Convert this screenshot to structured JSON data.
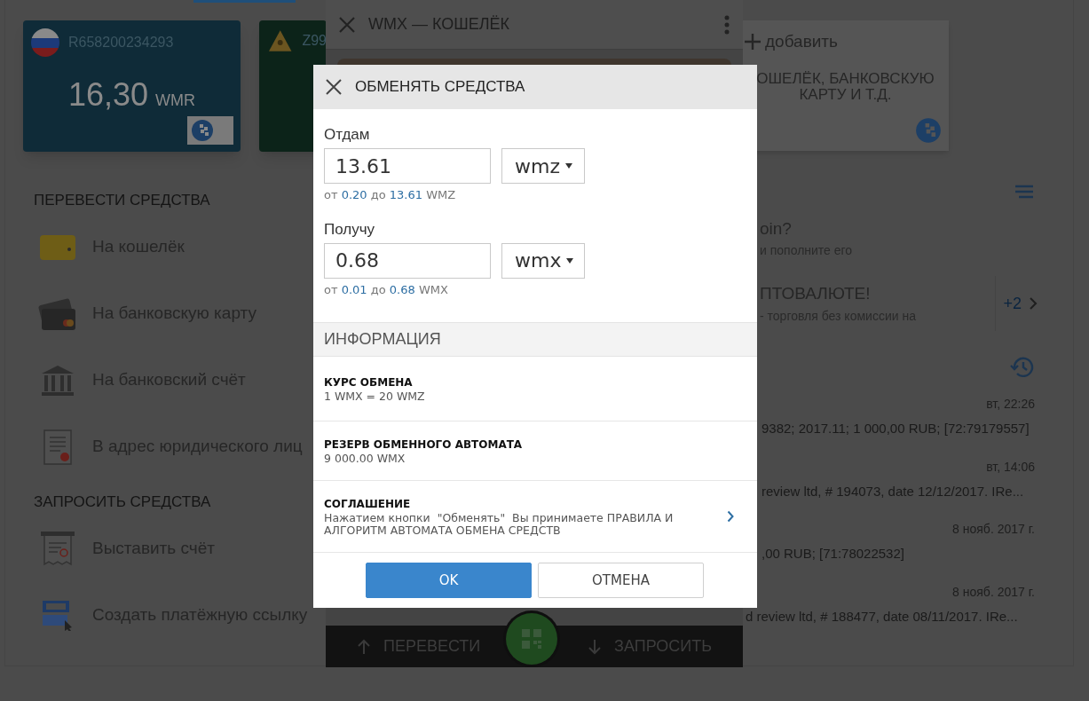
{
  "wallet_cards": [
    {
      "kind": "wmr",
      "number": "R658200234293",
      "amount": "16,30",
      "currency": "WMR"
    },
    {
      "kind": "wmz",
      "number": "Z99"
    }
  ],
  "add_card": {
    "label": "добавить",
    "lines": [
      "ОШЕЛЁК, БАНКОВСКУЮ",
      "КАРТУ И Т.Д."
    ]
  },
  "transfer": {
    "title": "ПЕРЕВЕСТИ СРЕДСТВА",
    "items": [
      {
        "kind": "wallet",
        "label": "На кошелёк"
      },
      {
        "kind": "card",
        "label": "На банковскую карту"
      },
      {
        "kind": "bank",
        "label": "На банковский счёт"
      },
      {
        "kind": "document",
        "label": "В адрес юридического лиц"
      }
    ]
  },
  "request": {
    "title": "ЗАПРОСИТЬ СРЕДСТВА",
    "items": [
      {
        "kind": "invoice",
        "label": "Выставить счёт"
      },
      {
        "kind": "link",
        "label": "Создать платёжную ссылку"
      }
    ]
  },
  "promos": [
    {
      "title": "oin?",
      "text": "и пополните его"
    },
    {
      "title": "ПТОВАЛЮТЕ!",
      "text": "- торговля без комиссии на",
      "more": "+2"
    }
  ],
  "history": [
    {
      "time": "вт, 22:26",
      "text": "9382; 2017.11; 1 000,00 RUB; [72:79179557]"
    },
    {
      "time": "вт, 14:06",
      "text": "review ltd, # 194073, date 12/12/2017. IRe..."
    },
    {
      "time": "8 нояб. 2017 г.",
      "text": ",00 RUB; [71:78022532]"
    },
    {
      "time": "8 нояб. 2017 г.",
      "text": "d review ltd, # 188477, date 08/11/2017. IRe..."
    }
  ],
  "wallet_panel": {
    "title": "WMX — КОШЕЛЁК",
    "actions": [
      {
        "kind": "send",
        "label": "ПЕРЕВЕСТИ"
      },
      {
        "kind": "request",
        "label": "ЗАПРОСИТЬ"
      }
    ]
  },
  "exchange_dialog": {
    "title": "ОБМЕНЯТЬ СРЕДСТВА",
    "fields": [
      {
        "label": "Отдам",
        "value": "13.61",
        "currency": "wmz",
        "hint": {
          "from_word": "от",
          "min": "0.20",
          "to_word": "до",
          "max": "13.61",
          "unit": "WMZ"
        }
      },
      {
        "label": "Получу",
        "value": "0.68",
        "currency": "wmx",
        "hint": {
          "from_word": "от",
          "min": "0.01",
          "to_word": "до",
          "max": "0.68",
          "unit": "WMX"
        }
      }
    ],
    "info_title": "ИНФОРМАЦИЯ",
    "info": [
      {
        "title": "КУРС ОБМЕНА",
        "text": "1 WMX = 20 WMZ"
      },
      {
        "title": "РЕЗЕРВ ОБМЕННОГО АВТОМАТА",
        "text": "9 000.00 WMX"
      },
      {
        "title": "СОГЛАШЕНИЕ",
        "text": "Нажатием кнопки  \"Обменять\"  Вы принимаете ПРАВИЛА И АЛГОРИТМ АВТОМАТА ОБМЕНА СРЕДСТВ",
        "link": true
      }
    ],
    "buttons": [
      {
        "kind": "primary",
        "label": "OK"
      },
      {
        "kind": "secondary",
        "label": "ОТМЕНА"
      }
    ]
  }
}
